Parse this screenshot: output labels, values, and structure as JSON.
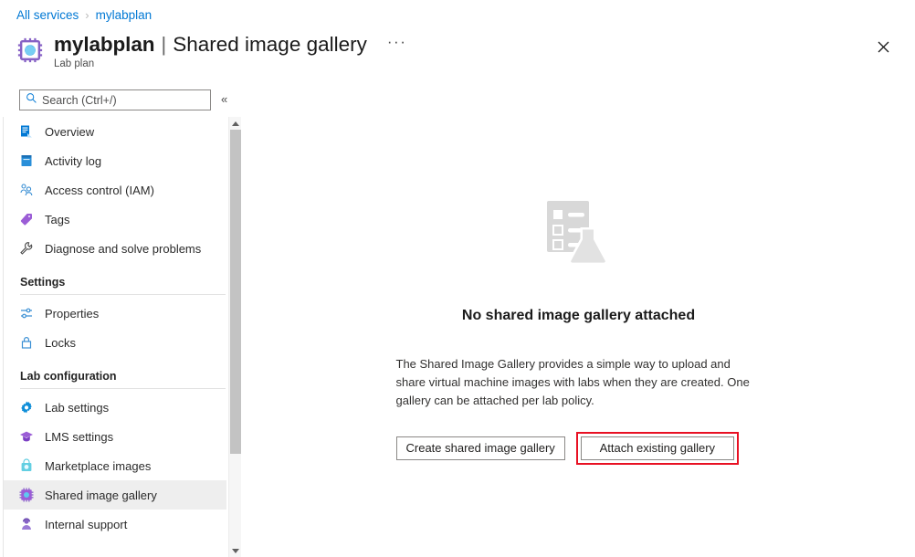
{
  "breadcrumb": {
    "items": [
      {
        "label": "All services",
        "icon": ""
      },
      {
        "label": "mylabplan",
        "icon": ""
      }
    ],
    "separator": "›"
  },
  "header": {
    "resource_icon": "lab-plan-chip-icon",
    "title": "mylabplan",
    "pipe": "|",
    "page": "Shared image gallery",
    "ellipsis": "···",
    "subtitle": "Lab plan",
    "close_icon": "close-icon"
  },
  "search": {
    "placeholder": "Search (Ctrl+/)",
    "value": "",
    "icon": "search-icon",
    "collapse_icon": "«"
  },
  "sidebar": {
    "items": [
      {
        "label": "Overview",
        "icon": "overview-icon",
        "type": "item",
        "selected": false
      },
      {
        "label": "Activity log",
        "icon": "activity-log-icon",
        "type": "item",
        "selected": false
      },
      {
        "label": "Access control (IAM)",
        "icon": "access-control-icon",
        "type": "item",
        "selected": false
      },
      {
        "label": "Tags",
        "icon": "tags-icon",
        "type": "item",
        "selected": false
      },
      {
        "label": "Diagnose and solve problems",
        "icon": "diagnose-icon",
        "type": "item",
        "selected": false
      },
      {
        "label": "Settings",
        "type": "group"
      },
      {
        "label": "Properties",
        "icon": "properties-icon",
        "type": "item",
        "selected": false
      },
      {
        "label": "Locks",
        "icon": "lock-icon",
        "type": "item",
        "selected": false
      },
      {
        "label": "Lab configuration",
        "type": "group"
      },
      {
        "label": "Lab settings",
        "icon": "gear-icon",
        "type": "item",
        "selected": false
      },
      {
        "label": "LMS settings",
        "icon": "graduation-cap-icon",
        "type": "item",
        "selected": false
      },
      {
        "label": "Marketplace images",
        "icon": "marketplace-icon",
        "type": "item",
        "selected": false
      },
      {
        "label": "Shared image gallery",
        "icon": "shared-gallery-chip-icon",
        "type": "item",
        "selected": true
      },
      {
        "label": "Internal support",
        "icon": "internal-support-icon",
        "type": "item",
        "selected": false
      }
    ],
    "scrollbar": {
      "up_arrow": "▲",
      "down_arrow": "▼"
    }
  },
  "main": {
    "illustration": "empty-checklist-flask-icon",
    "title": "No shared image gallery attached",
    "description": "The Shared Image Gallery provides a simple way to upload and share virtual machine images with labs when they are created. One gallery can be attached per lab policy.",
    "primary_button": "Create shared image gallery",
    "secondary_button": "Attach existing gallery"
  },
  "colors": {
    "link": "#0078d4",
    "highlight": "#e81123",
    "selected_row": "#eeeeee",
    "illustration": "#d6d6d6"
  }
}
